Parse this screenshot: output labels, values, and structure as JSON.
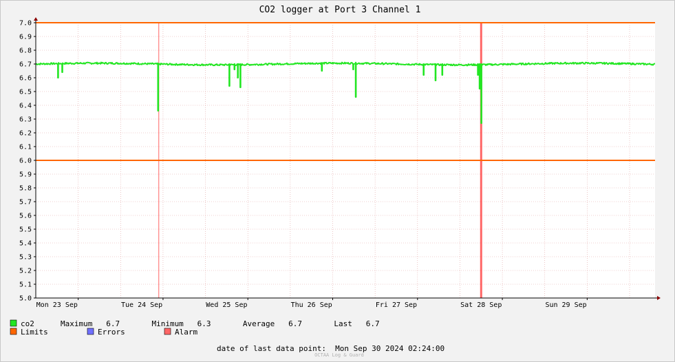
{
  "chart_data": {
    "type": "line",
    "title": "CO2 logger at Port 3 Channel 1",
    "ylim": [
      5.0,
      7.0
    ],
    "y_ticks": [
      "7.0",
      "6.9",
      "6.8",
      "6.7",
      "6.6",
      "6.5",
      "6.4",
      "6.3",
      "6.2",
      "6.1",
      "6.0",
      "5.9",
      "5.8",
      "5.7",
      "5.6",
      "5.5",
      "5.4",
      "5.3",
      "5.2",
      "5.1",
      "5.0"
    ],
    "x_range_days": [
      0,
      7.3
    ],
    "x_labels": [
      "Mon 23 Sep",
      "Tue 24 Sep",
      "Wed 25 Sep",
      "Thu 26 Sep",
      "Fri 27 Sep",
      "Sat 28 Sep",
      "Sun 29 Sep"
    ],
    "grid": true,
    "limits": [
      6.0,
      7.0
    ],
    "alarm_markers_days": [
      1.45,
      5.25
    ],
    "series": [
      {
        "name": "co2",
        "color": "#22e622",
        "baseline": 6.7,
        "dips": [
          {
            "day": 0.26,
            "value": 6.6
          },
          {
            "day": 0.31,
            "value": 6.64
          },
          {
            "day": 1.44,
            "value": 6.36
          },
          {
            "day": 2.28,
            "value": 6.54
          },
          {
            "day": 2.34,
            "value": 6.66
          },
          {
            "day": 2.38,
            "value": 6.6
          },
          {
            "day": 2.41,
            "value": 6.53
          },
          {
            "day": 3.37,
            "value": 6.65
          },
          {
            "day": 3.74,
            "value": 6.66
          },
          {
            "day": 3.77,
            "value": 6.46
          },
          {
            "day": 4.57,
            "value": 6.62
          },
          {
            "day": 4.71,
            "value": 6.58
          },
          {
            "day": 4.79,
            "value": 6.62
          },
          {
            "day": 5.21,
            "value": 6.62
          },
          {
            "day": 5.23,
            "value": 6.52
          },
          {
            "day": 5.25,
            "value": 6.27
          }
        ]
      }
    ],
    "colors": {
      "co2": "#22e622",
      "limits": "#ff6600",
      "errors": "#7070ff",
      "alarm": "#ff6666"
    }
  },
  "legend": {
    "co2_label": "co2",
    "stats": "Maximum   6.7       Minimum   6.3       Average   6.7       Last   6.7",
    "limits_label": "Limits",
    "errors_label": "Errors",
    "alarm_label": "Alarm"
  },
  "footer": {
    "last_data_point": "date of last data point:  Mon Sep 30 2024 02:24:00",
    "watermark": "OCTAA Log & Guard"
  }
}
